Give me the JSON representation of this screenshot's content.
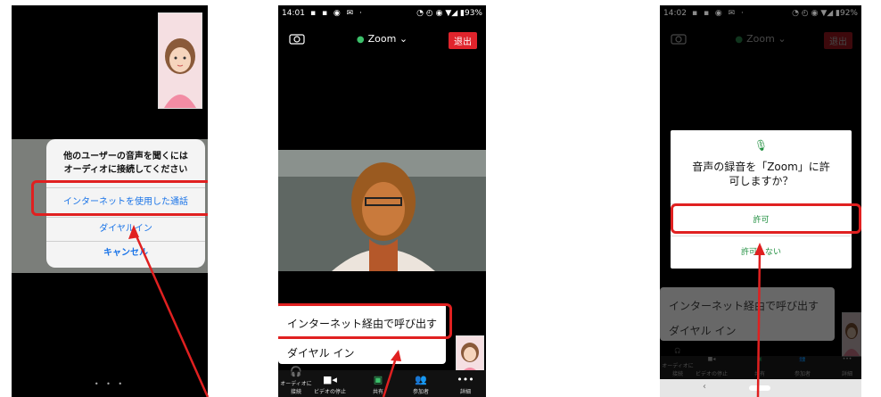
{
  "screen1": {
    "dialog_message": "他のユーザーの音声を聞くには\nオーディオに接続してください",
    "options": [
      "インターネットを使用した通話",
      "ダイヤルイン",
      "キャンセル"
    ]
  },
  "screen2": {
    "status_time": "14:01",
    "battery": "93%",
    "meeting_title": "Zoom",
    "leave_label": "退出",
    "sheet_options": [
      "インターネット経由で呼び出す",
      "ダイヤル イン"
    ],
    "bottom_bar": [
      "オーディオに接続",
      "ビデオの停止",
      "共有",
      "参加者",
      "詳細"
    ]
  },
  "screen3": {
    "status_time": "14:02",
    "battery": "92%",
    "meeting_title": "Zoom",
    "leave_label": "退出",
    "permission_question": "音声の録音を「Zoom」に許\n可しますか？",
    "allow_label": "許可",
    "deny_label": "許可しない",
    "background_options": [
      "インターネット経由で呼び出す",
      "ダイヤル イン"
    ],
    "bottom_bar": [
      "オーディオに接続",
      "ビデオの停止",
      "共有",
      "参加者",
      "詳細"
    ]
  },
  "colors": {
    "highlight": "#e02020",
    "leave_red": "#e0242c",
    "android_green": "#1e8e3e",
    "ios_blue": "#1a74e8"
  }
}
